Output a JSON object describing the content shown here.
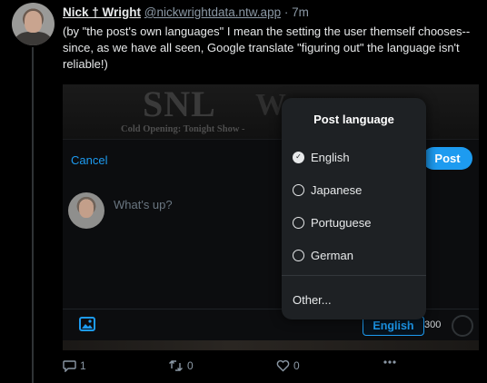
{
  "post": {
    "author_name": "Nick † Wright",
    "handle": "@nickwrightdata.ntw.app",
    "separator": "·",
    "time": "7m",
    "body": "(by \"the post's own languages\" I mean the setting the user themself chooses--since, as we have all seen, Google translate \"figuring out\" the language isn't reliable!)"
  },
  "embed": {
    "banner_logo": "SNL",
    "banner_logo_secondary": "W",
    "banner_subtitle": "Cold Opening: Tonight Show -",
    "cancel_label": "Cancel",
    "post_label": "Post",
    "compose_placeholder": "What's up?",
    "language_chip": "English",
    "char_count": "300",
    "popover": {
      "title": "Post language",
      "options": [
        {
          "label": "English",
          "checked": true
        },
        {
          "label": "Japanese",
          "checked": false
        },
        {
          "label": "Portuguese",
          "checked": false
        },
        {
          "label": "German",
          "checked": false
        }
      ],
      "other_label": "Other..."
    }
  },
  "actions": {
    "replies": "1",
    "reposts": "0",
    "likes": "0"
  },
  "colors": {
    "accent": "#1d9bf0",
    "background": "#000000",
    "muted": "#8b98a5",
    "popover_bg": "#1e2124"
  },
  "icons": [
    "reply-icon",
    "repost-icon",
    "like-icon",
    "more-icon",
    "image-icon",
    "check-icon"
  ]
}
